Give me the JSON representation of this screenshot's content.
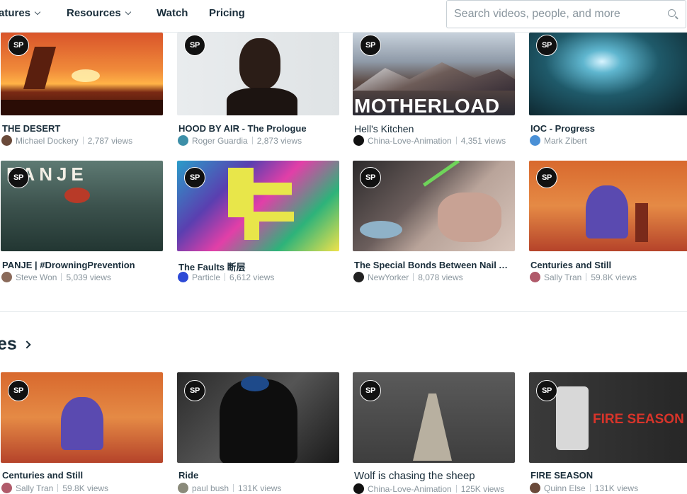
{
  "nav": {
    "features": "atures",
    "resources": "Resources",
    "watch": "Watch",
    "pricing": "Pricing"
  },
  "search": {
    "placeholder": "Search videos, people, and more"
  },
  "badge": "SP",
  "rows": [
    [
      {
        "title": "THE DESERT",
        "author": "Michael Dockery",
        "views": "2,787 views"
      },
      {
        "title": "HOOD BY AIR - The Prologue",
        "author": "Roger Guardia",
        "views": "2,873 views"
      },
      {
        "title": "Hell's Kitchen",
        "author": "China-Love-Animation",
        "views": "4,351 views",
        "thumb_text": "MOTHERLOAD"
      },
      {
        "title": "IOC - Progress",
        "author": "Mark Zibert",
        "views": ""
      }
    ],
    [
      {
        "title": "PANJE | #DrowningPrevention",
        "author": "Steve Won",
        "views": "5,039 views",
        "thumb_text": "PANJE"
      },
      {
        "title": "The Faults 断层",
        "author": "Particle",
        "views": "6,612 views"
      },
      {
        "title": "The Special Bonds Between Nail Artists and Their Clients",
        "author": "NewYorker",
        "views": "8,078 views"
      },
      {
        "title": "Centuries and Still",
        "author": "Sally Tran",
        "views": "59.8K views"
      }
    ]
  ],
  "section_heading": "es",
  "row3": [
    {
      "title": "Centuries and Still",
      "author": "Sally Tran",
      "views": "59.8K views"
    },
    {
      "title": "Ride",
      "author": "paul bush",
      "views": "131K views"
    },
    {
      "title": "Wolf is chasing the sheep",
      "author": "China-Love-Animation",
      "views": "125K views"
    },
    {
      "title": "FIRE SEASON",
      "author": "Quinn Else",
      "views": "131K views",
      "thumb_text": "FIRE SEASON"
    }
  ],
  "colors": {
    "text_dark": "#1a2e3b",
    "text_muted": "#8a969e",
    "badge_bg": "#111111"
  }
}
